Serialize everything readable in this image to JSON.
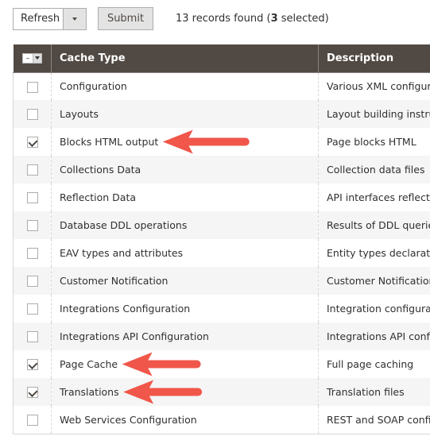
{
  "toolbar": {
    "action_label": "Refresh",
    "submit_label": "Submit",
    "records_prefix": "13 records found (",
    "selected_count": "3",
    "records_suffix": " selected)"
  },
  "grid": {
    "columns": {
      "cache_type": "Cache Type",
      "description": "Description"
    },
    "rows": [
      {
        "cache_type": "Configuration",
        "description": "Various XML configurations",
        "checked": false
      },
      {
        "cache_type": "Layouts",
        "description": "Layout building instructions",
        "checked": false
      },
      {
        "cache_type": "Blocks HTML output",
        "description": "Page blocks HTML",
        "checked": true
      },
      {
        "cache_type": "Collections Data",
        "description": "Collection data files",
        "checked": false
      },
      {
        "cache_type": "Reflection Data",
        "description": "API interfaces reflection data",
        "checked": false
      },
      {
        "cache_type": "Database DDL operations",
        "description": "Results of DDL queries, such as describing tables or indexes",
        "checked": false
      },
      {
        "cache_type": "EAV types and attributes",
        "description": "Entity types declaration cache",
        "checked": false
      },
      {
        "cache_type": "Customer Notification",
        "description": "Customer Notification",
        "checked": false
      },
      {
        "cache_type": "Integrations Configuration",
        "description": "Integration configuration file",
        "checked": false
      },
      {
        "cache_type": "Integrations API Configuration",
        "description": "Integrations API configuration file",
        "checked": false
      },
      {
        "cache_type": "Page Cache",
        "description": "Full page caching",
        "checked": true
      },
      {
        "cache_type": "Translations",
        "description": "Translation files",
        "checked": true
      },
      {
        "cache_type": "Web Services Configuration",
        "description": "REST and SOAP configurations, generated WSDL file",
        "checked": false
      }
    ]
  },
  "annotations": {
    "arrow_color": "#f0564a",
    "arrows_point_to": [
      "Blocks HTML output",
      "Page Cache",
      "Translations"
    ]
  }
}
